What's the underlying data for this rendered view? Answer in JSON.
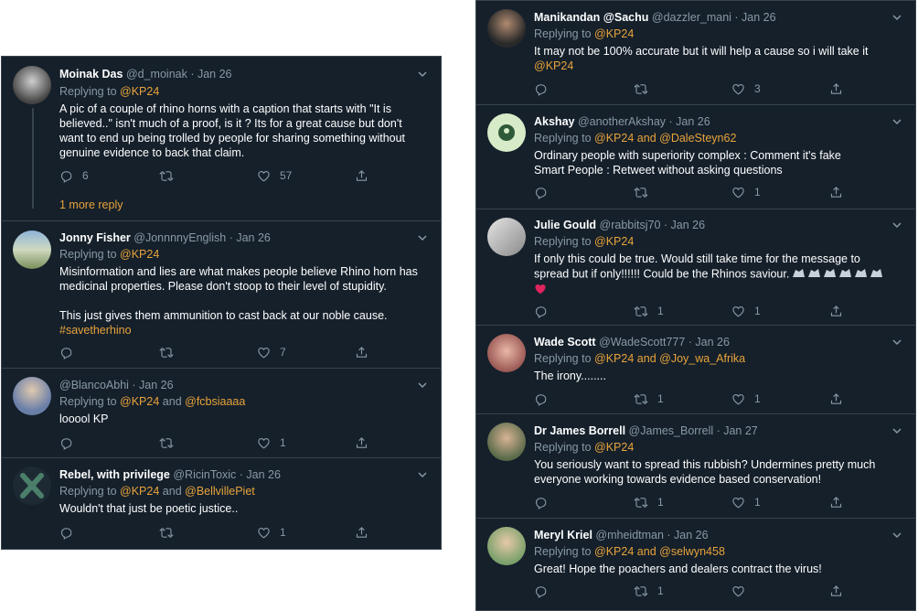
{
  "replying_to": "Replying to",
  "and": "and",
  "colors": {
    "background": "#15202b",
    "border": "#38444d",
    "text": "#ffffff",
    "muted": "#8899a6",
    "link": "#e8a33a",
    "heart": "#e0245e"
  },
  "left": {
    "tweets": [
      {
        "name": "Moinak Das",
        "handle": "@d_moinak · Jan 26",
        "reply": [
          "@KP24"
        ],
        "lines": [
          "A pic of a couple of rhino horns with a caption that starts with \"It is",
          "believed..\" isn't much of a proof, is it ? Its for a great cause but don't",
          "want to end up being trolled by people for sharing something without",
          "genuine evidence to back that claim."
        ],
        "counts": {
          "reply": "6",
          "retweet": "",
          "like": "57"
        },
        "more_reply": "1 more reply"
      },
      {
        "name": "Jonny Fisher",
        "handle": "@JonnnnyEnglish · Jan 26",
        "reply": [
          "@KP24"
        ],
        "lines": [
          "Misinformation and lies are what makes people believe Rhino horn has",
          "medicinal properties. Please don't stoop to their level of stupidity.",
          "",
          "This just gives them ammunition to cast back at our noble cause."
        ],
        "hashtag": "#savetherhino",
        "counts": {
          "reply": "",
          "retweet": "",
          "like": "7"
        }
      },
      {
        "name": "",
        "handle": "@BlancoAbhi · Jan 26",
        "reply": [
          "@KP24",
          "@fcbsiaaaa"
        ],
        "lines": [
          "looool KP"
        ],
        "counts": {
          "reply": "",
          "retweet": "",
          "like": "1"
        }
      },
      {
        "name": "Rebel, with privilege",
        "handle": "@RicinToxic · Jan 26",
        "reply": [
          "@KP24",
          "@BellvillePiet"
        ],
        "lines": [
          "Wouldn't that just be poetic justice.."
        ],
        "counts": {
          "reply": "",
          "retweet": "",
          "like": "1"
        }
      }
    ]
  },
  "right": {
    "tweets": [
      {
        "name": "Manikandan @Sachu",
        "handle": "@dazzler_mani · Jan 26",
        "reply": [],
        "lines": [
          "It may not be 100% accurate but it will help a cause so i will take it"
        ],
        "tail_link": "@KP24",
        "counts": {
          "reply": "",
          "retweet": "",
          "like": "3"
        }
      },
      {
        "name": "Akshay",
        "handle": "@anotherAkshay · Jan 26",
        "reply": [
          "@KP24",
          "@DaleSteyn62"
        ],
        "lines": [
          "Ordinary people with superiority complex : Comment it's fake",
          "Smart People : Retweet without asking questions"
        ],
        "counts": {
          "reply": "",
          "retweet": "",
          "like": "1"
        }
      },
      {
        "name": "Julie Gould",
        "handle": "@rabbitsj70 · Jan 26",
        "reply": [
          "@KP24"
        ],
        "lines": [
          "If only this could be true. Would still take time for the message to",
          "spread but if only!!!!!! Could be the Rhinos saviour."
        ],
        "counts": {
          "reply": "",
          "retweet": "1",
          "like": "1"
        }
      },
      {
        "name": "Wade Scott",
        "handle": "@WadeScott777 · Jan 26",
        "reply": [
          "@KP24",
          "@Joy_wa_Afrika"
        ],
        "lines": [
          "The irony........"
        ],
        "counts": {
          "reply": "",
          "retweet": "1",
          "like": "1"
        }
      },
      {
        "name": "Dr James Borrell",
        "handle": "@James_Borrell · Jan 27",
        "reply": [
          "@KP24"
        ],
        "lines": [
          "You seriously want to spread this rubbish? Undermines pretty much",
          "everyone working towards evidence based conservation!"
        ],
        "counts": {
          "reply": "",
          "retweet": "1",
          "like": "1"
        }
      },
      {
        "name": "Meryl Kriel",
        "handle": "@mheidtman · Jan 26",
        "reply": [
          "@KP24",
          "@selwyn458"
        ],
        "lines": [
          "Great! Hope the poachers and dealers contract the virus!"
        ],
        "counts": {
          "reply": "",
          "retweet": "1",
          "like": ""
        }
      }
    ]
  }
}
